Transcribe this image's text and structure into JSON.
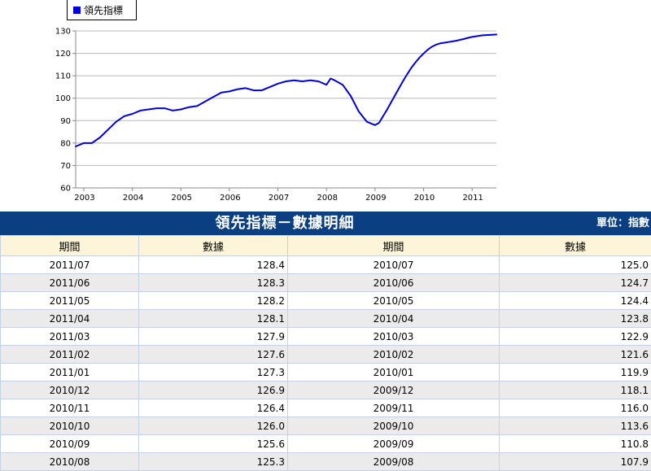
{
  "chart_data": {
    "type": "line",
    "title": "",
    "xlabel": "",
    "ylabel": "",
    "ylim": [
      60,
      130
    ],
    "yticks": [
      60,
      70,
      80,
      90,
      100,
      110,
      120,
      130
    ],
    "xlim": [
      "2002-11",
      "2011-07"
    ],
    "xticks": [
      "2003",
      "2004",
      "2005",
      "2006",
      "2007",
      "2008",
      "2009",
      "2010",
      "2011"
    ],
    "grid": true,
    "legend": "top-left",
    "series": [
      {
        "name": "領先指標",
        "color": "#0000dd",
        "x": [
          "2002-11",
          "2003-01",
          "2003-03",
          "2003-05",
          "2003-07",
          "2003-09",
          "2003-11",
          "2004-01",
          "2004-03",
          "2004-05",
          "2004-07",
          "2004-09",
          "2004-11",
          "2005-01",
          "2005-03",
          "2005-05",
          "2005-07",
          "2005-09",
          "2005-11",
          "2006-01",
          "2006-03",
          "2006-05",
          "2006-07",
          "2006-09",
          "2006-11",
          "2007-01",
          "2007-03",
          "2007-05",
          "2007-07",
          "2007-09",
          "2007-11",
          "2008-01",
          "2008-02",
          "2008-03",
          "2008-05",
          "2008-07",
          "2008-09",
          "2008-11",
          "2009-01",
          "2009-02",
          "2009-04",
          "2009-06",
          "2009-08",
          "2009-09",
          "2009-10",
          "2009-11",
          "2009-12",
          "2010-01",
          "2010-02",
          "2010-03",
          "2010-04",
          "2010-05",
          "2010-06",
          "2010-07",
          "2010-08",
          "2010-09",
          "2010-10",
          "2010-11",
          "2010-12",
          "2011-01",
          "2011-02",
          "2011-03",
          "2011-04",
          "2011-05",
          "2011-06",
          "2011-07"
        ],
        "values": [
          78.5,
          80.0,
          80.0,
          82.5,
          86.0,
          89.5,
          92.0,
          93.0,
          94.5,
          95.0,
          95.5,
          95.5,
          94.5,
          95.0,
          96.0,
          96.5,
          98.5,
          100.5,
          102.5,
          103.0,
          104.0,
          104.5,
          103.5,
          103.5,
          105.0,
          106.5,
          107.5,
          108.0,
          107.5,
          108.0,
          107.5,
          106.0,
          108.8,
          108.0,
          106.0,
          101.0,
          94.0,
          89.5,
          88.0,
          89.0,
          95.0,
          101.5,
          107.9,
          110.8,
          113.6,
          116.0,
          118.1,
          119.9,
          121.6,
          122.9,
          123.8,
          124.4,
          124.7,
          125.0,
          125.3,
          125.6,
          126.0,
          126.4,
          126.9,
          127.3,
          127.6,
          127.9,
          128.1,
          128.2,
          128.3,
          128.4
        ]
      }
    ]
  },
  "table": {
    "title": "領先指標－數據明細",
    "unit": "單位：指數",
    "headers": [
      "期間",
      "數據",
      "期間",
      "數據"
    ],
    "rows": [
      [
        "2011/07",
        "128.4",
        "2010/07",
        "125.0"
      ],
      [
        "2011/06",
        "128.3",
        "2010/06",
        "124.7"
      ],
      [
        "2011/05",
        "128.2",
        "2010/05",
        "124.4"
      ],
      [
        "2011/04",
        "128.1",
        "2010/04",
        "123.8"
      ],
      [
        "2011/03",
        "127.9",
        "2010/03",
        "122.9"
      ],
      [
        "2011/02",
        "127.6",
        "2010/02",
        "121.6"
      ],
      [
        "2011/01",
        "127.3",
        "2010/01",
        "119.9"
      ],
      [
        "2010/12",
        "126.9",
        "2009/12",
        "118.1"
      ],
      [
        "2010/11",
        "126.4",
        "2009/11",
        "116.0"
      ],
      [
        "2010/10",
        "126.0",
        "2009/10",
        "113.6"
      ],
      [
        "2010/09",
        "125.6",
        "2009/09",
        "110.8"
      ],
      [
        "2010/08",
        "125.3",
        "2009/08",
        "107.9"
      ]
    ]
  }
}
